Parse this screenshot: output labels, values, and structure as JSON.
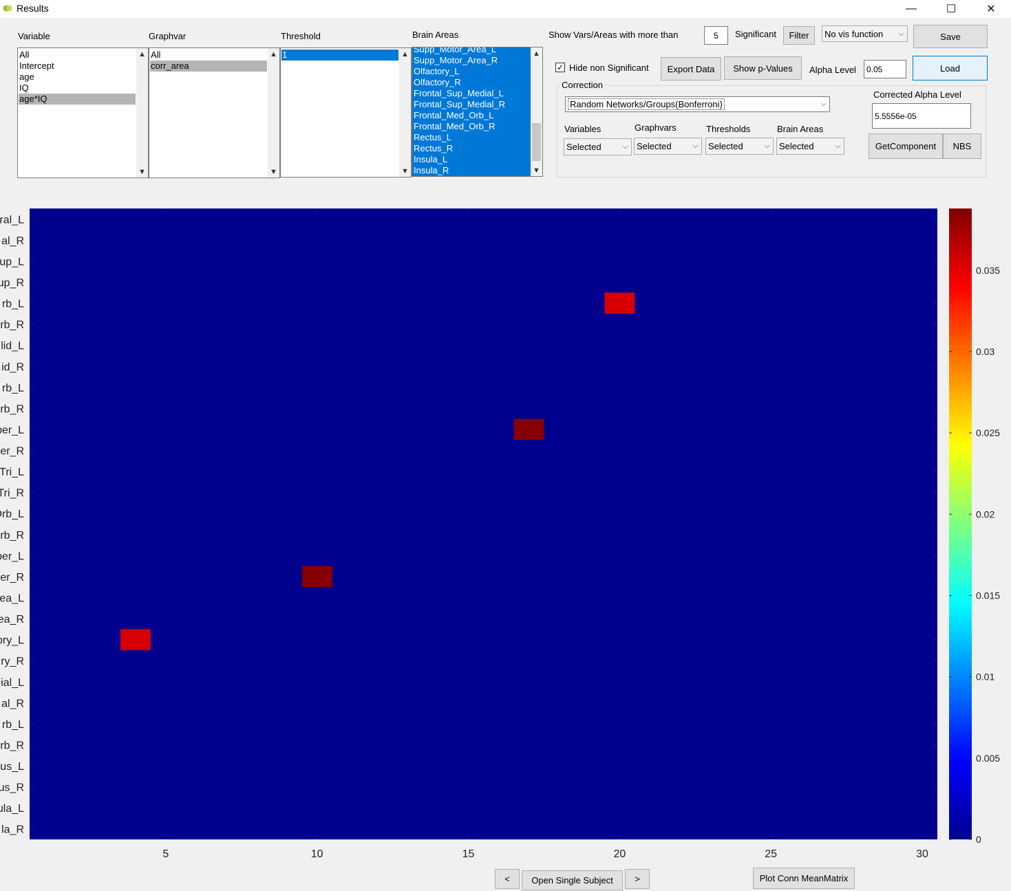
{
  "window": {
    "title": "Results",
    "minimize": "—",
    "maximize": "☐",
    "close": "✕"
  },
  "panels": {
    "variable": {
      "label": "Variable",
      "items": [
        "All",
        "Intercept",
        "age",
        "IQ",
        "age*IQ"
      ],
      "selected": "age*IQ"
    },
    "graphvar": {
      "label": "Graphvar",
      "items": [
        "All",
        "corr_area"
      ],
      "selected": "corr_area"
    },
    "threshold": {
      "label": "Threshold",
      "items": [
        "1"
      ],
      "selected": "1"
    },
    "brain_areas": {
      "label": "Brain Areas",
      "items": [
        "Supp_Motor_Area_L",
        "Supp_Motor_Area_R",
        "Olfactory_L",
        "Olfactory_R",
        "Frontal_Sup_Medial_L",
        "Frontal_Sup_Medial_R",
        "Frontal_Med_Orb_L",
        "Frontal_Med_Orb_R",
        "Rectus_L",
        "Rectus_R",
        "Insula_L",
        "Insula_R"
      ]
    }
  },
  "controls": {
    "show_vars_label": "Show Vars/Areas with more than",
    "show_vars_value": "5",
    "significant_label": "Significant",
    "filter_button": "Filter",
    "vis_function": "No vis function",
    "save_button": "Save",
    "hide_non_significant": "Hide non Significant",
    "hide_checked": "✓",
    "export_button": "Export Data",
    "show_pvalues_button": "Show p-Values",
    "alpha_label": "Alpha Level",
    "alpha_value": "0.05",
    "load_button": "Load",
    "correction_label": "Correction",
    "correction_value": "Random Networks/Groups(Bonferroni)",
    "corrected_alpha_label": "Corrected Alpha Level",
    "corrected_alpha_value": "5.5556e-05",
    "variables_label": "Variables",
    "variables_value": "Selected",
    "graphvars_label": "Graphvars",
    "graphvars_value": "Selected",
    "thresholds_label": "Thresholds",
    "thresholds_value": "Selected",
    "brainareas_label": "Brain Areas",
    "brainareas_value": "Selected",
    "getcomponent_button": "GetComponent",
    "nbs_button": "NBS"
  },
  "bottom": {
    "prev_button": "<",
    "open_single_subject_button": "Open Single Subject",
    "next_button": ">",
    "plot_conn_button": "Plot Conn MeanMatrix"
  },
  "chart_data": {
    "type": "heatmap",
    "x": {
      "ticks": [
        5,
        10,
        15,
        20,
        25,
        30
      ],
      "range": [
        0.5,
        30.5
      ]
    },
    "y": {
      "labels": [
        "ral_L",
        "al_R",
        "up_L",
        "up_R",
        "rb_L",
        "rb_R",
        "lid_L",
        "id_R",
        "rb_L",
        "rb_R",
        "per_L",
        "er_R",
        "Tri_L",
        "Tri_R",
        "Orb_L",
        "rb_R",
        "per_L",
        "er_R",
        "ea_L",
        "ea_R",
        "ory_L",
        "ry_R",
        "ial_L",
        "al_R",
        "rb_L",
        "rb_R",
        "us_L",
        "us_R",
        "ula_L",
        "la_R"
      ]
    },
    "background_value": 0,
    "cells": [
      {
        "x": 20,
        "row": 4,
        "value": 0.0355
      },
      {
        "x": 17,
        "row": 10,
        "value": 0.0385
      },
      {
        "x": 10,
        "row": 17,
        "value": 0.0385
      },
      {
        "x": 4,
        "row": 20,
        "value": 0.0355
      }
    ],
    "colorbar": {
      "ticks": [
        "0",
        "0.005",
        "0.01",
        "0.015",
        "0.02",
        "0.025",
        "0.03",
        "0.035"
      ],
      "tick_values": [
        0,
        0.005,
        0.01,
        0.015,
        0.02,
        0.025,
        0.03,
        0.035
      ],
      "range": [
        0,
        0.0388
      ],
      "colormap": "jet"
    }
  }
}
